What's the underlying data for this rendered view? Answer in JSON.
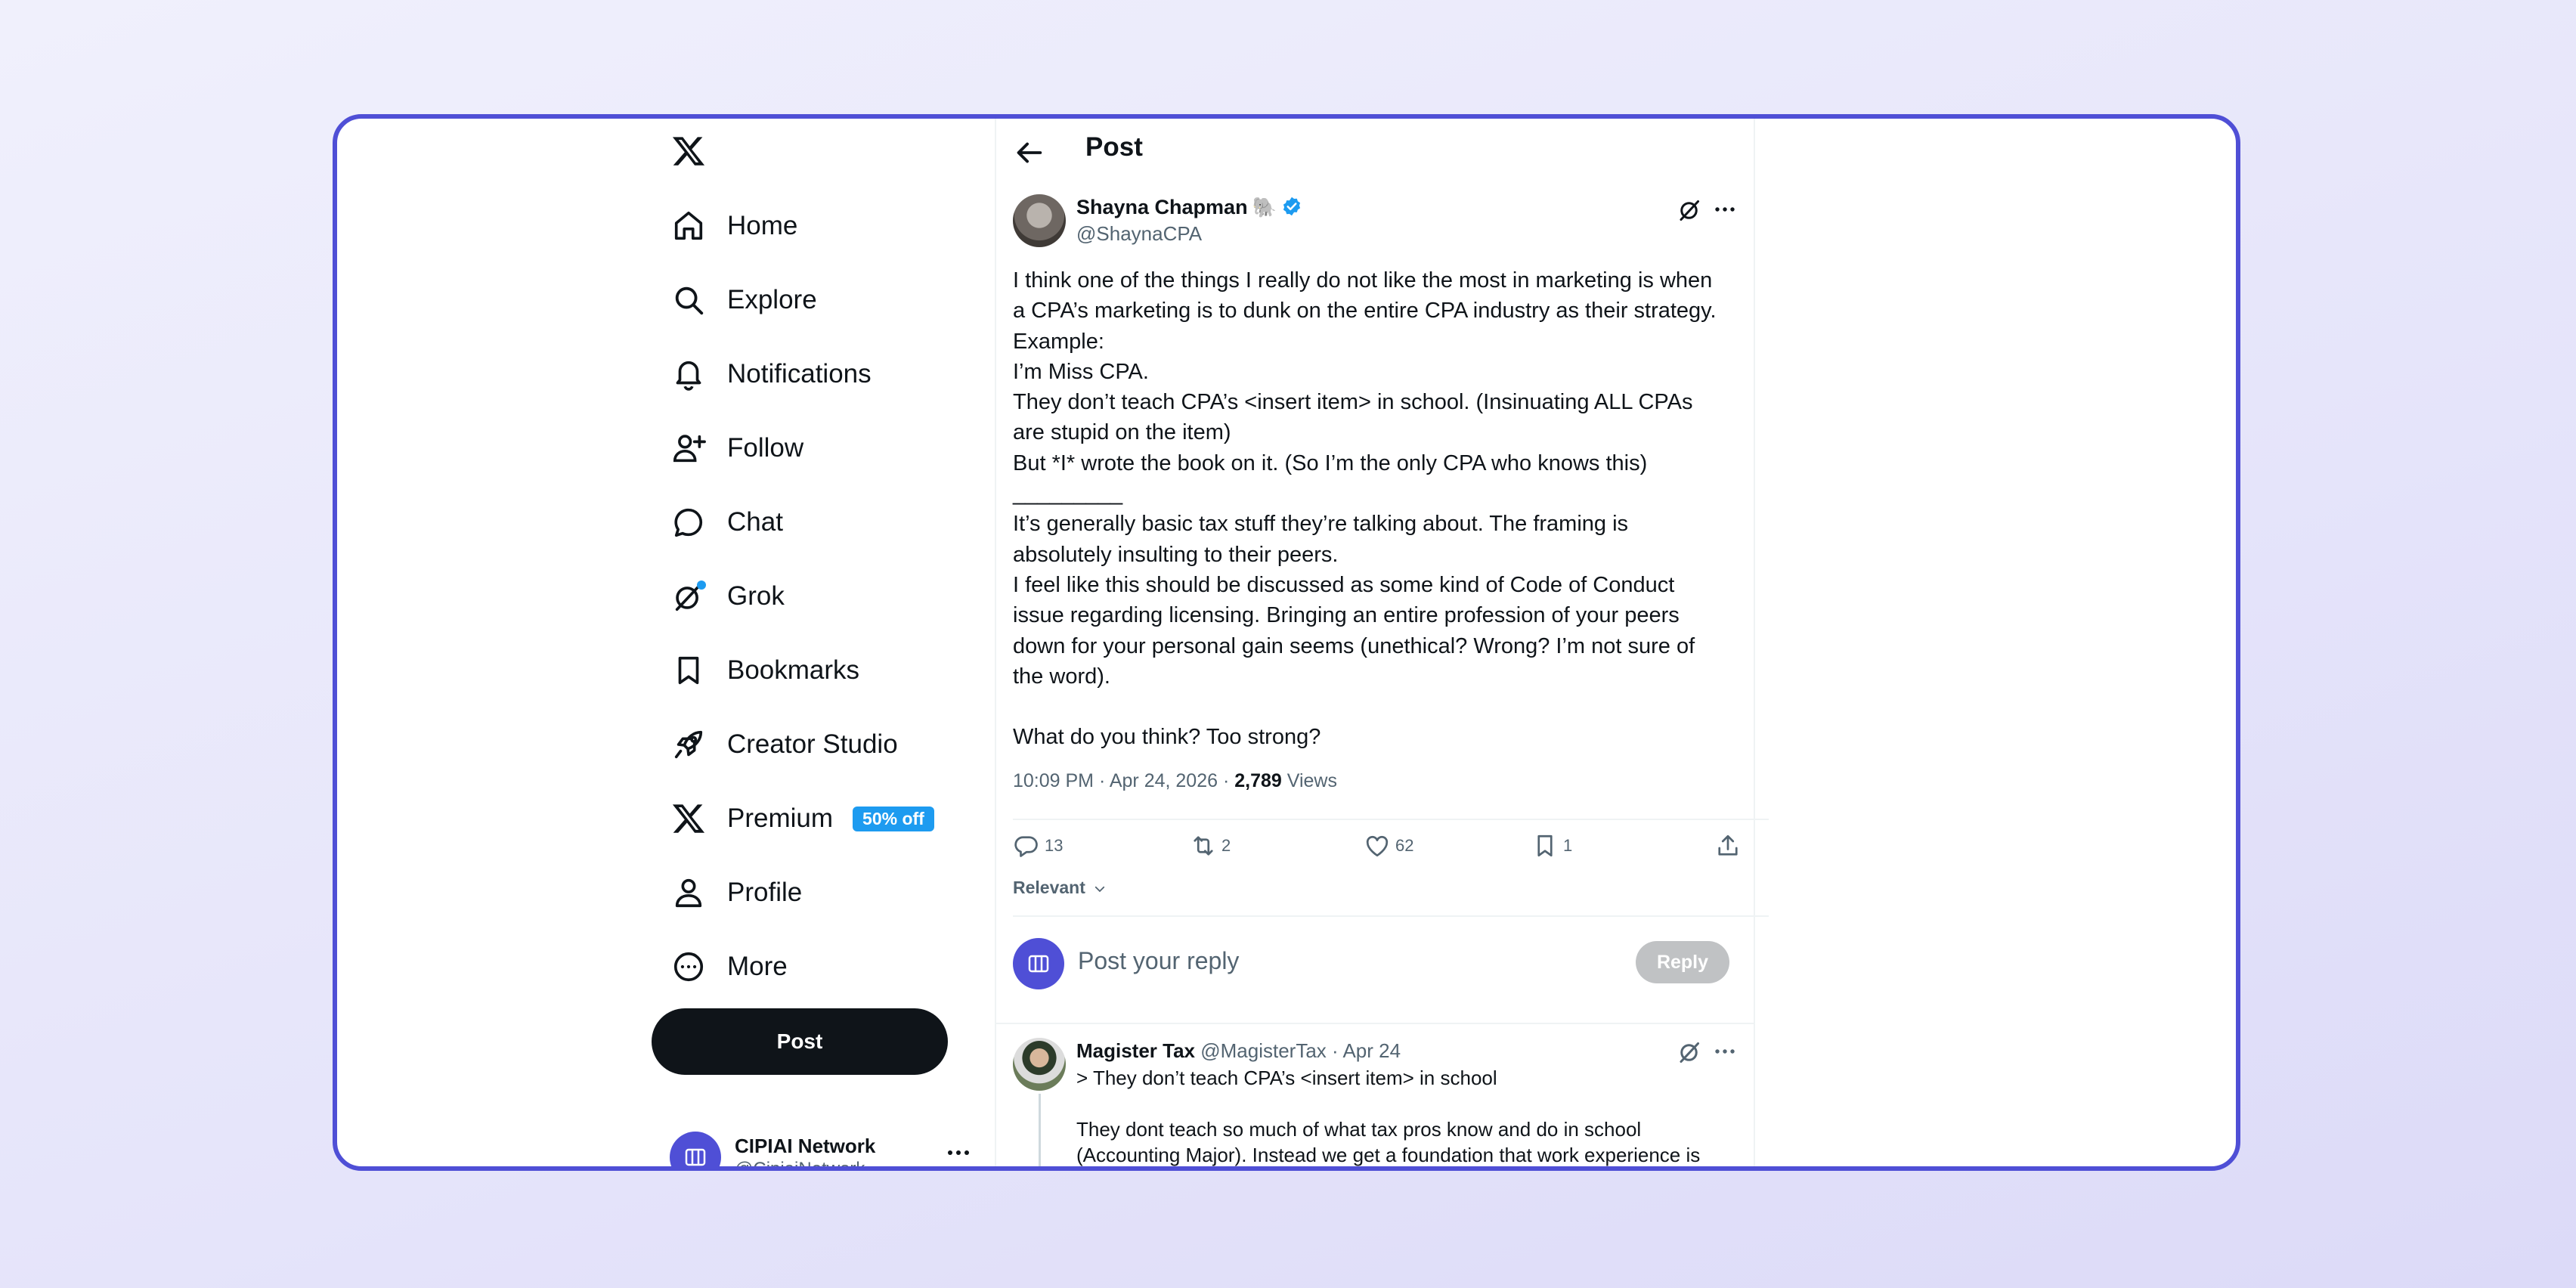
{
  "nav": {
    "items": [
      {
        "label": "Home",
        "icon": "home-icon"
      },
      {
        "label": "Explore",
        "icon": "search-icon"
      },
      {
        "label": "Notifications",
        "icon": "bell-icon"
      },
      {
        "label": "Follow",
        "icon": "person-add-icon"
      },
      {
        "label": "Chat",
        "icon": "chat-bubble-icon"
      },
      {
        "label": "Grok",
        "icon": "grok-icon"
      },
      {
        "label": "Bookmarks",
        "icon": "bookmark-icon"
      },
      {
        "label": "Creator Studio",
        "icon": "rocket-icon"
      },
      {
        "label": "Premium",
        "icon": "x-logo-icon",
        "badge": "50% off"
      },
      {
        "label": "Profile",
        "icon": "person-icon"
      },
      {
        "label": "More",
        "icon": "more-circle-icon"
      }
    ],
    "post_button": "Post"
  },
  "account": {
    "name": "CIPIAI Network",
    "handle": "@CipiaiNetwork"
  },
  "header": {
    "title": "Post"
  },
  "post": {
    "author_name": "Shayna Chapman",
    "author_emoji": "🐘",
    "author_handle": "@ShaynaCPA",
    "lines": [
      "I think one of the things I really do not like the most in marketing is when",
      "a CPA’s marketing is to dunk on the entire CPA industry as their strategy.",
      "Example:",
      "I’m Miss CPA.",
      "They don’t teach CPA’s <insert item> in school. (Insinuating ALL CPAs",
      "are stupid on the item)",
      "But *I* wrote the book on it. (So I’m the only CPA who knows this)",
      "_________",
      "It’s generally basic tax stuff they’re talking about. The framing is",
      "absolutely insulting to their peers.",
      "I feel like this should be discussed as some kind of Code of Conduct",
      "issue regarding licensing. Bringing an entire profession of your peers",
      "down for your personal gain seems (unethical? Wrong? I’m not sure of",
      "the word).",
      "",
      "What do you think? Too strong?"
    ],
    "time": "10:09 PM · Apr 24, 2026 · ",
    "views_count": "2,789",
    "views_label": " Views",
    "stats": {
      "replies": "13",
      "reposts": "2",
      "likes": "62",
      "bookmarks": "1"
    }
  },
  "sort": {
    "label": "Relevant"
  },
  "composer": {
    "placeholder": "Post your reply",
    "button": "Reply"
  },
  "reply": {
    "name": "Magister Tax",
    "meta": " @MagisterTax · Apr 24",
    "quote": "> They don’t teach CPA’s <insert item> in school",
    "body": "They dont teach so much of what tax pros know and do in school (Accounting Major).  Instead we get a foundation that work experience is"
  },
  "colors": {
    "accent": "#4f4fd6",
    "verified": "#1d9bf0",
    "text": "#0f1419",
    "muted": "#536471"
  }
}
